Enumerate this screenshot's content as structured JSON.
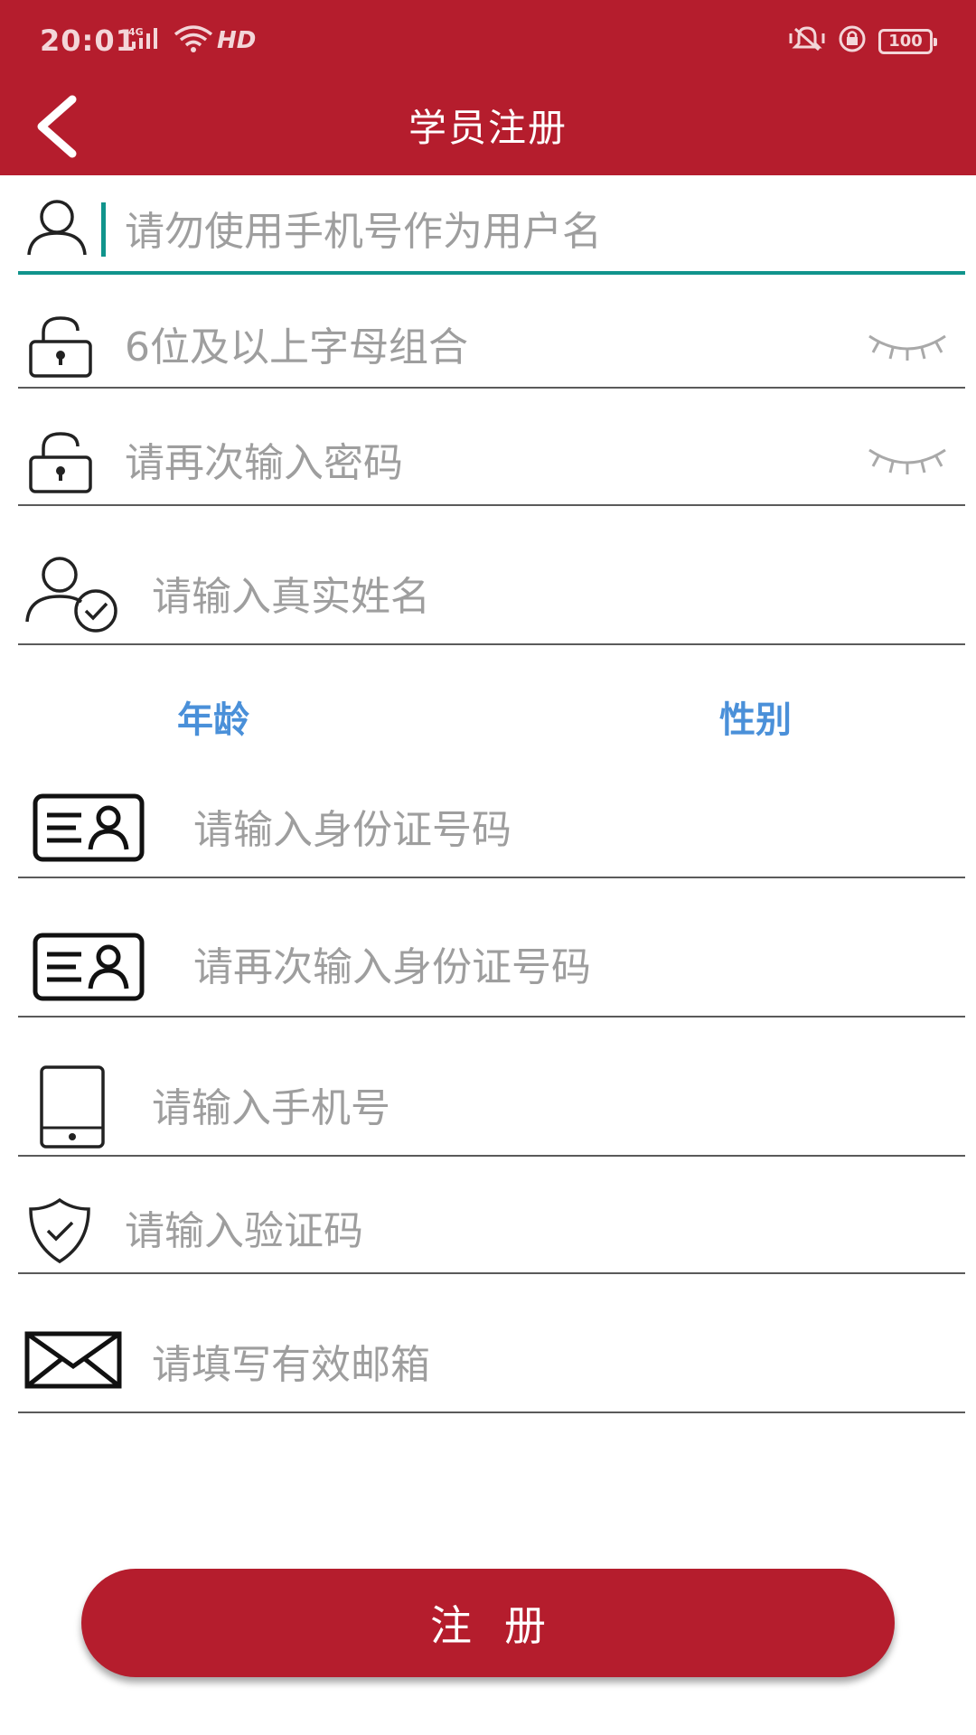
{
  "status_bar": {
    "time": "20:01",
    "network": "4G",
    "hd": "HD",
    "battery": "100"
  },
  "header": {
    "title": "学员注册"
  },
  "form": {
    "username": {
      "placeholder": "请勿使用手机号作为用户名",
      "value": ""
    },
    "password": {
      "placeholder": "6位及以上字母组合",
      "value": ""
    },
    "password_confirm": {
      "placeholder": "请再次输入密码",
      "value": ""
    },
    "real_name": {
      "placeholder": "请输入真实姓名",
      "value": ""
    },
    "age_label": "年龄",
    "gender_label": "性别",
    "id_number": {
      "placeholder": "请输入身份证号码",
      "value": ""
    },
    "id_number_confirm": {
      "placeholder": "请再次输入身份证号码",
      "value": ""
    },
    "phone": {
      "placeholder": "请输入手机号",
      "value": ""
    },
    "verify_code": {
      "placeholder": "请输入验证码",
      "value": ""
    },
    "email": {
      "placeholder": "请填写有效邮箱",
      "value": ""
    }
  },
  "actions": {
    "register_label": "注册"
  },
  "colors": {
    "brand": "#b51d2d",
    "focus": "#10948c",
    "link": "#4a90d9",
    "placeholder": "#9e9e9e"
  }
}
